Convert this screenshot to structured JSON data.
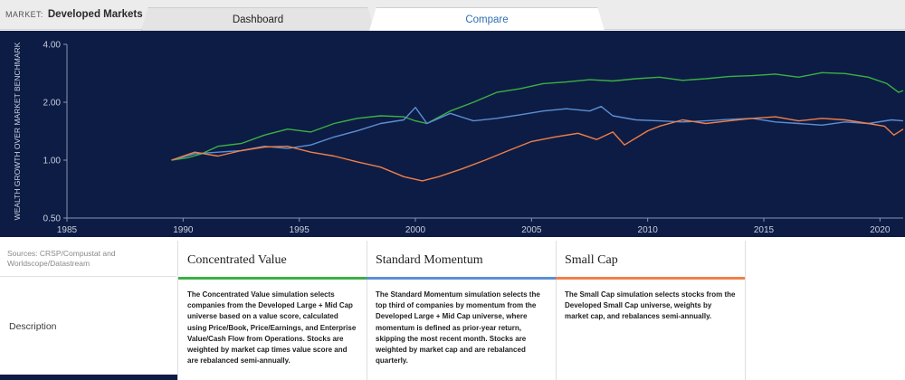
{
  "header": {
    "market_label": "MARKET:",
    "market_value": "Developed Markets",
    "tabs": [
      {
        "label": "Dashboard",
        "active": false
      },
      {
        "label": "Compare",
        "active": true
      }
    ]
  },
  "chart_data": {
    "type": "line",
    "ylabel": "WEALTH GROWTH OVER MARKET BENCHMARK",
    "yscale": "log",
    "ylim": [
      0.5,
      4.0
    ],
    "xlim": [
      1985,
      2021
    ],
    "x_ticks": [
      1985,
      1990,
      1995,
      2000,
      2005,
      2010,
      2015,
      2020
    ],
    "y_ticks": [
      0.5,
      1.0,
      2.0,
      4.0
    ],
    "y_tick_labels": [
      "0.50",
      "1.00",
      "2.00",
      "4.00"
    ],
    "grid": false,
    "series": [
      {
        "name": "Concentrated Value",
        "color": "#3cb043",
        "x": [
          1989.5,
          1990.2,
          1990.8,
          1991.5,
          1992.5,
          1993.5,
          1994.5,
          1995.5,
          1996.5,
          1997.5,
          1998.5,
          1999.5,
          2000.0,
          2000.5,
          2001.5,
          2002.5,
          2003.5,
          2004.5,
          2005.5,
          2006.5,
          2007.5,
          2008.5,
          2009.5,
          2010.5,
          2011.5,
          2012.5,
          2013.5,
          2014.5,
          2015.5,
          2016.5,
          2017.5,
          2018.5,
          2019.5,
          2020.3,
          2020.8,
          2021.0
        ],
        "y": [
          1.0,
          1.03,
          1.08,
          1.18,
          1.22,
          1.35,
          1.45,
          1.4,
          1.55,
          1.65,
          1.7,
          1.68,
          1.6,
          1.55,
          1.8,
          2.0,
          2.25,
          2.35,
          2.5,
          2.55,
          2.62,
          2.58,
          2.65,
          2.7,
          2.6,
          2.65,
          2.72,
          2.75,
          2.8,
          2.7,
          2.85,
          2.82,
          2.7,
          2.5,
          2.25,
          2.3
        ]
      },
      {
        "name": "Standard Momentum",
        "color": "#5b8fd4",
        "x": [
          1989.5,
          1990.5,
          1991.5,
          1992.5,
          1993.5,
          1994.5,
          1995.5,
          1996.5,
          1997.5,
          1998.5,
          1999.5,
          2000.0,
          2000.5,
          2001.5,
          2002.5,
          2003.5,
          2004.5,
          2005.5,
          2006.5,
          2007.5,
          2008.0,
          2008.5,
          2009.5,
          2010.5,
          2011.5,
          2012.5,
          2013.5,
          2014.5,
          2015.5,
          2016.5,
          2017.5,
          2018.5,
          2019.5,
          2020.5,
          2021.0
        ],
        "y": [
          1.0,
          1.08,
          1.1,
          1.12,
          1.18,
          1.15,
          1.2,
          1.32,
          1.42,
          1.55,
          1.62,
          1.88,
          1.55,
          1.75,
          1.6,
          1.65,
          1.72,
          1.8,
          1.85,
          1.8,
          1.9,
          1.7,
          1.62,
          1.6,
          1.58,
          1.6,
          1.63,
          1.65,
          1.58,
          1.55,
          1.52,
          1.58,
          1.55,
          1.62,
          1.6
        ]
      },
      {
        "name": "Small Cap",
        "color": "#f07f47",
        "x": [
          1989.5,
          1990.5,
          1991.5,
          1992.5,
          1993.5,
          1994.5,
          1995.5,
          1996.5,
          1997.5,
          1998.5,
          1999.5,
          2000.3,
          2001.0,
          2002.0,
          2003.0,
          2004.0,
          2005.0,
          2006.0,
          2007.0,
          2007.8,
          2008.5,
          2009.0,
          2010.0,
          2010.5,
          2011.5,
          2012.5,
          2013.5,
          2014.5,
          2015.5,
          2016.5,
          2017.5,
          2018.5,
          2019.5,
          2020.2,
          2020.6,
          2021.0
        ],
        "y": [
          1.0,
          1.1,
          1.05,
          1.12,
          1.17,
          1.18,
          1.1,
          1.05,
          0.98,
          0.92,
          0.82,
          0.78,
          0.82,
          0.9,
          1.0,
          1.12,
          1.25,
          1.32,
          1.38,
          1.28,
          1.4,
          1.2,
          1.42,
          1.5,
          1.62,
          1.55,
          1.6,
          1.65,
          1.68,
          1.6,
          1.65,
          1.62,
          1.55,
          1.5,
          1.35,
          1.45
        ]
      }
    ]
  },
  "sources": "Sources: CRSP/Compustat and Worldscope/Datastream",
  "description_label": "Description",
  "strategies": [
    {
      "name": "Concentrated Value",
      "color": "#3cb043",
      "description": "The Concentrated Value simulation selects companies from the Developed Large + Mid Cap universe based on a value score, calculated using Price/Book, Price/Earnings, and Enterprise Value/Cash Flow from Operations. Stocks are weighted by market cap times value score and are rebalanced semi-annually."
    },
    {
      "name": "Standard Momentum",
      "color": "#5b8fd4",
      "description": "The Standard Momentum simulation selects the top third of companies by momentum from the Developed Large + Mid Cap universe, where momentum is defined as prior-year return, skipping the most recent month. Stocks are weighted by market cap and are rebalanced quarterly."
    },
    {
      "name": "Small Cap",
      "color": "#f07f47",
      "description": "The Small Cap simulation selects stocks from the Developed Small Cap universe, weights by market cap, and rebalances semi-annually."
    }
  ]
}
